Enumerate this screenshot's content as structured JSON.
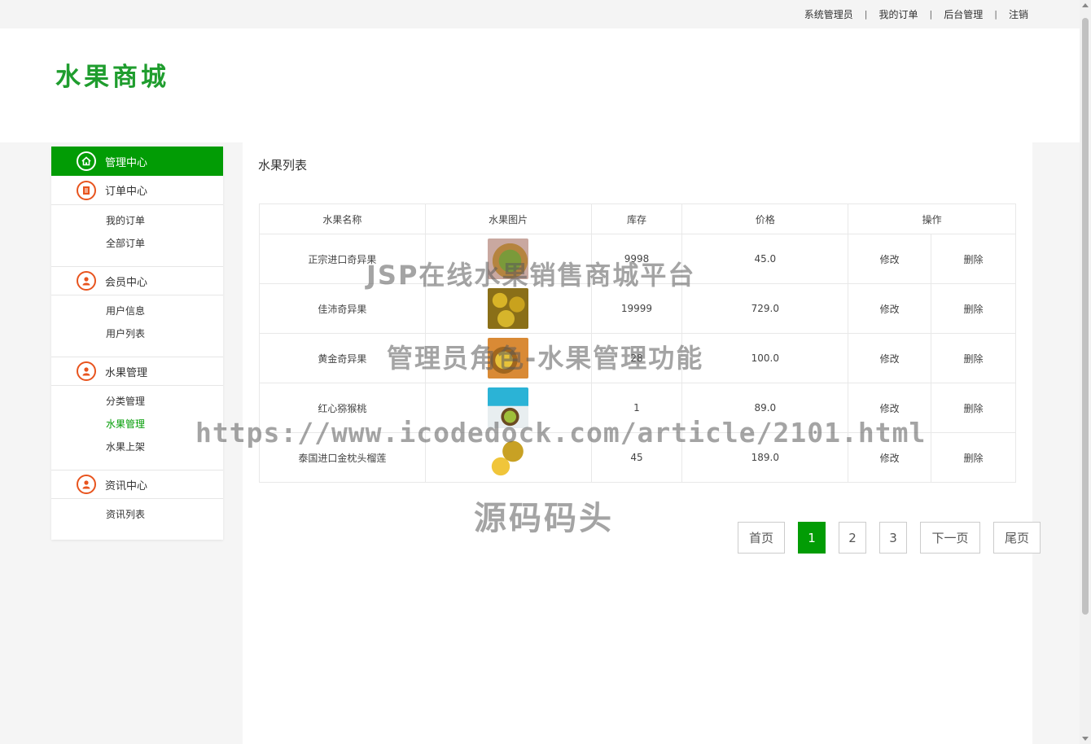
{
  "topnav": {
    "items": [
      "系统管理员",
      "我的订单",
      "后台管理",
      "注销"
    ],
    "separator": "|"
  },
  "header": {
    "logo": "水果商城"
  },
  "sidebar": {
    "groups": [
      {
        "label": "管理中心",
        "icon": "home-icon",
        "active": true,
        "items": []
      },
      {
        "label": "订单中心",
        "icon": "list-icon",
        "items": [
          "我的订单",
          "全部订单"
        ]
      },
      {
        "label": "会员中心",
        "icon": "user-icon",
        "items": [
          "用户信息",
          "用户列表"
        ]
      },
      {
        "label": "水果管理",
        "icon": "user-icon",
        "items": [
          "分类管理",
          "水果管理",
          "水果上架"
        ],
        "current": "水果管理"
      },
      {
        "label": "资讯中心",
        "icon": "user-icon",
        "items": [
          "资讯列表"
        ]
      }
    ]
  },
  "main": {
    "title": "水果列表",
    "table": {
      "headers": [
        "水果名称",
        "水果图片",
        "库存",
        "价格",
        "操作"
      ],
      "rows": [
        {
          "name": "正宗进口奇异果",
          "stock": "9998",
          "price": "45.0",
          "edit": "修改",
          "delete": "删除"
        },
        {
          "name": "佳沛奇异果",
          "stock": "19999",
          "price": "729.0",
          "edit": "修改",
          "delete": "删除"
        },
        {
          "name": "黄金奇异果",
          "stock": "28",
          "price": "100.0",
          "edit": "修改",
          "delete": "删除"
        },
        {
          "name": "红心猕猴桃",
          "stock": "1",
          "price": "89.0",
          "edit": "修改",
          "delete": "删除"
        },
        {
          "name": "泰国进口金枕头榴莲",
          "stock": "45",
          "price": "189.0",
          "edit": "修改",
          "delete": "删除"
        }
      ]
    },
    "pager": {
      "first": "首页",
      "pages": [
        "1",
        "2",
        "3"
      ],
      "current": "1",
      "next": "下一页",
      "last": "尾页"
    }
  },
  "watermark": {
    "line1": "JSP在线水果销售商城平台",
    "line2": "管理员角色-水果管理功能",
    "line3": "https://www.icodedock.com/article/2101.html",
    "line4": "源码码头"
  },
  "colors": {
    "accent": "#029c05",
    "logo": "#1f9d2e",
    "icon": "#e8541e"
  }
}
